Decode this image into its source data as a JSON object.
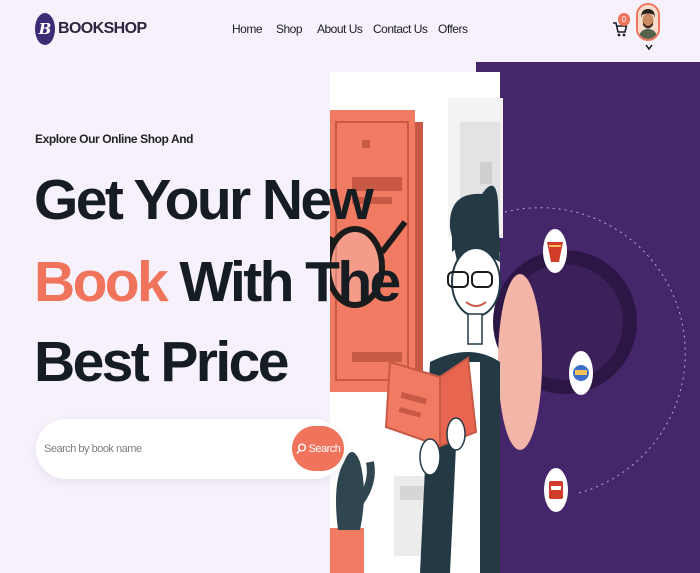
{
  "brand": {
    "initial": "B",
    "name": "BOOKSHOP"
  },
  "nav": {
    "links": [
      {
        "label": "Home"
      },
      {
        "label": "Shop"
      },
      {
        "label": "About Us"
      },
      {
        "label": "Contact Us"
      },
      {
        "label": "Offers"
      }
    ],
    "cart_count": "0"
  },
  "hero": {
    "eyebrow": "Explore Our Online Shop And",
    "line1": "Get Your New",
    "line2_accent": "Book",
    "line2_rest": " With The",
    "line3": "Best Price"
  },
  "search": {
    "placeholder": "Search by book name",
    "button_label": "Search"
  },
  "colors": {
    "accent": "#f0735c",
    "brand_purple": "#46266b",
    "background": "#f6f1fb"
  },
  "icons": [
    "cart-icon",
    "search-icon",
    "chevron-down-icon",
    "user-avatar"
  ]
}
